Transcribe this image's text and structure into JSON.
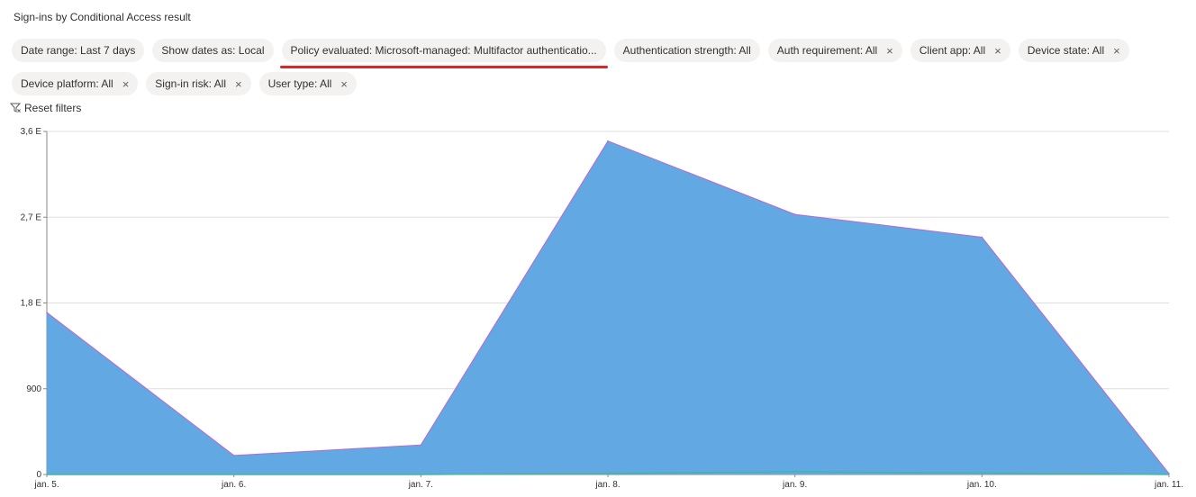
{
  "title": "Sign-ins by Conditional Access result",
  "filters_row1": [
    {
      "label": "Date range: Last 7 days",
      "closable": false,
      "highlight": false
    },
    {
      "label": "Show dates as: Local",
      "closable": false,
      "highlight": false
    },
    {
      "label": "Policy evaluated: Microsoft-managed: Multifactor authenticatio...",
      "closable": false,
      "highlight": true
    },
    {
      "label": "Authentication strength: All",
      "closable": false,
      "highlight": false
    },
    {
      "label": "Auth requirement: All",
      "closable": true,
      "highlight": false
    },
    {
      "label": "Client app: All",
      "closable": true,
      "highlight": false
    },
    {
      "label": "Device state: All",
      "closable": true,
      "highlight": false
    }
  ],
  "filters_row2": [
    {
      "label": "Device platform: All",
      "closable": true,
      "highlight": false
    },
    {
      "label": "Sign-in risk: All",
      "closable": true,
      "highlight": false
    },
    {
      "label": "User type: All",
      "closable": true,
      "highlight": false
    }
  ],
  "close_glyph": "×",
  "reset_label": "Reset filters",
  "colors": {
    "area_fill": "#62a8e2",
    "area_stroke": "#c066c8",
    "teal_line": "#3cb7a8",
    "highlight_underline": "#d62a2a",
    "grid": "#e1dfdd"
  },
  "chart_data": {
    "type": "area",
    "title": "",
    "xlabel": "",
    "ylabel": "",
    "categories": [
      "jan. 5.",
      "jan. 6.",
      "jan. 7.",
      "jan. 8.",
      "jan. 9.",
      "jan. 10.",
      "jan. 11."
    ],
    "ylim": [
      0,
      3600
    ],
    "yticks": [
      0,
      900,
      1800,
      2700,
      3600
    ],
    "ytick_labels": [
      "0",
      "900",
      "1,8 E",
      "2,7 E",
      "3,6 E"
    ],
    "grid": true,
    "legend": "none",
    "series": [
      {
        "values": [
          1700,
          200,
          310,
          3500,
          2730,
          2490,
          10
        ]
      },
      {
        "values": [
          0,
          0,
          0,
          10,
          30,
          15,
          0
        ]
      }
    ]
  }
}
